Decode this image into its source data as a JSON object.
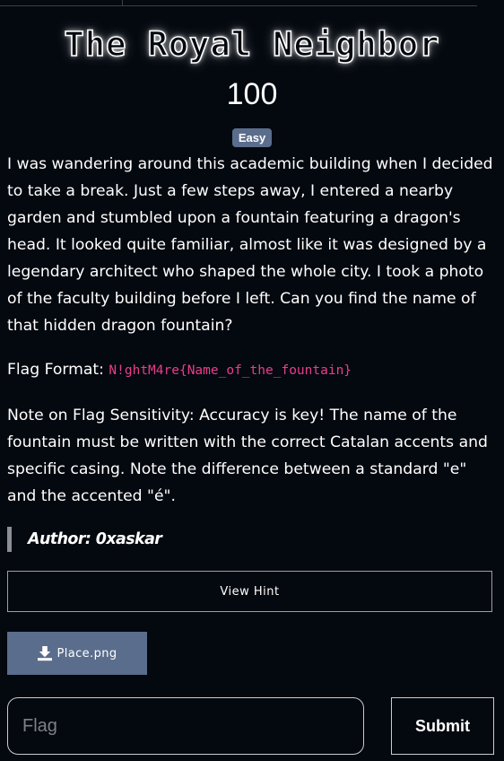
{
  "challenge": {
    "title": "The Royal Neighbor",
    "points": "100",
    "difficulty": "Easy",
    "description": "I was wandering around this academic building when I decided to take a break. Just a few steps away, I entered a nearby garden and stumbled upon a fountain featuring a dragon's head. It looked quite familiar, almost like it was designed by a legendary architect who shaped the whole city. I took a photo of the faculty building before I left. Can you find the name of that hidden dragon fountain?",
    "flag_format_label": "Flag Format:",
    "flag_format_value": "N!ghtM4re{Name_of_the_fountain}",
    "note": "Note on Flag Sensitivity: Accuracy is key! The name of the fountain must be written with the correct Catalan accents and specific casing. Note the difference between a standard \"e\" and the accented \"é\".",
    "author": "Author: 0xaskar"
  },
  "actions": {
    "hint_label": "View Hint",
    "download_label": "Place.png",
    "download_icon": "download-icon",
    "flag_placeholder": "Flag",
    "flag_value": "",
    "submit_label": "Submit"
  },
  "colors": {
    "background": "#04080f",
    "badge": "#5a6d8c",
    "code": "#e83e8c",
    "download_button": "#5a6d8c"
  }
}
